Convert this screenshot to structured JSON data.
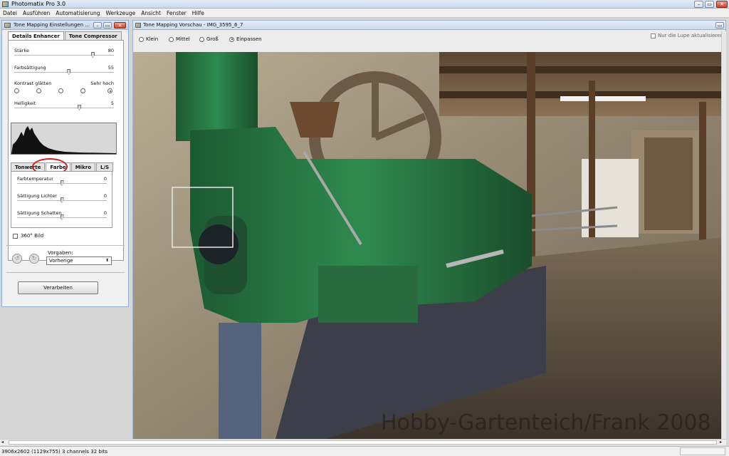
{
  "app": {
    "title": "Photomatix Pro 3.0",
    "menu": [
      "Datei",
      "Ausführen",
      "Automatisierung",
      "Werkzeuge",
      "Ansicht",
      "Fenster",
      "Hilfe"
    ]
  },
  "settings": {
    "title": "Tone Mapping Einstellungen ...",
    "tabs": [
      "Details Enhancer",
      "Tone Compressor"
    ],
    "sliders": [
      {
        "label": "Stärke",
        "value": "80",
        "fraction": 0.8
      },
      {
        "label": "Farbsättigung",
        "value": "55",
        "fraction": 0.55
      }
    ],
    "contrast": {
      "label": "Kontrast glätten",
      "max_label": "Sehr hoch",
      "options": 5,
      "selected": 4
    },
    "brightness": {
      "label": "Helligkeit",
      "value": "5",
      "fraction": 0.66
    },
    "subtabs": [
      "Tonwerte",
      "Farbe",
      "Mikro",
      "L/S"
    ],
    "color_sliders": [
      {
        "label": "Farbtemperatur",
        "value": "0",
        "fraction": 0.5
      },
      {
        "label": "Sättigung Lichter",
        "value": "0",
        "fraction": 0.5
      },
      {
        "label": "Sättigung Schatten",
        "value": "0",
        "fraction": 0.5
      }
    ],
    "checkbox_360": "360° Bild",
    "presets_label": "Vorgaben:",
    "presets_value": "Vorherige",
    "process_button": "Verarbeiten",
    "highlight_color": "#cc2222"
  },
  "preview": {
    "title": "Tone Mapping Vorschau - IMG_3595_6_7",
    "sizes": [
      "Klein",
      "Mittel",
      "Groß",
      "Einpassen"
    ],
    "selected_size": 3,
    "loupe_checkbox": "Nur die Lupe aktualisieren",
    "watermark": "Hobby-Gartenteich/Frank 2008"
  },
  "status": {
    "text": "3906x2602 (1129x755) 3 channels 32 bits"
  }
}
